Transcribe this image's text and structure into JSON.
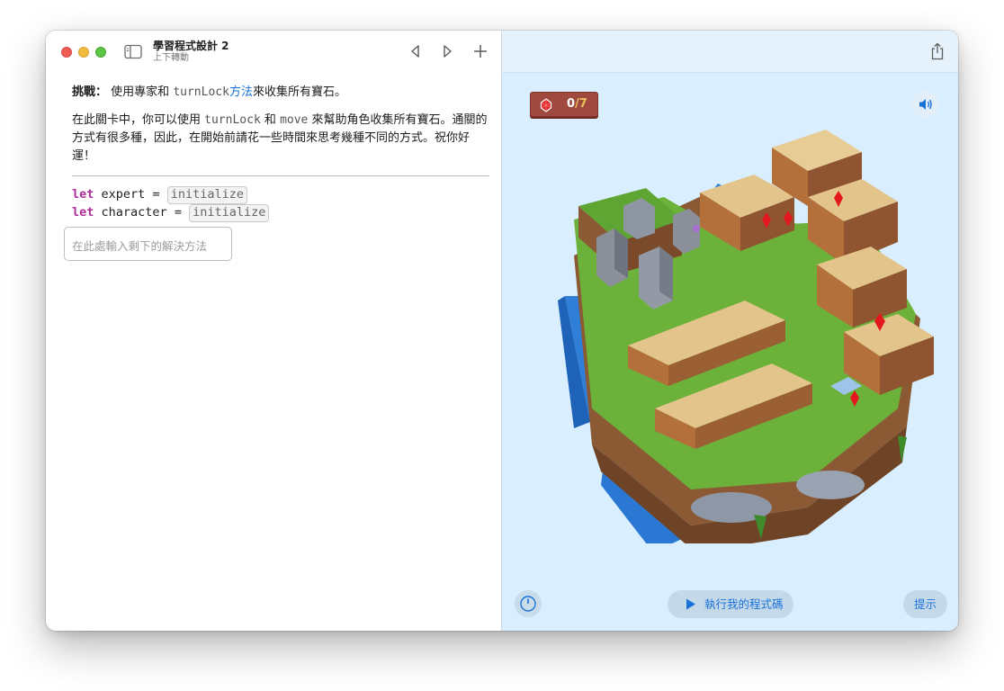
{
  "window": {
    "title": "學習程式設計 2",
    "subtitle": "上下轉動"
  },
  "toolbar": {
    "icons": [
      "sidebar-toggle-icon",
      "chevron-left-icon",
      "chevron-right-icon",
      "plus-icon",
      "share-icon"
    ]
  },
  "instructions": {
    "challenge_label": "挑戰：",
    "challenge_text_1": "使用專家和",
    "challenge_code": "turnLock",
    "challenge_link": "方法",
    "challenge_text_2": "來收集所有寶石。",
    "desc_1": "在此關卡中，你可以使用",
    "desc_code_1": "turnLock",
    "desc_2": "和",
    "desc_code_2": "move",
    "desc_3": "來幫助角色收集所有寶石。通關的方式有很多種，因此，在開始前請花一些時間來思考幾種不同的方式。祝你好運！"
  },
  "code": {
    "line1": {
      "keyword": "let",
      "name": "expert",
      "op": "=",
      "placeholder": "initialize"
    },
    "line2": {
      "keyword": "let",
      "name": "character",
      "op": "=",
      "placeholder": "initialize"
    },
    "input_placeholder": "在此處輸入剩下的解決方法"
  },
  "live_view": {
    "gems_collected": "0",
    "gems_separator": "/",
    "gems_total": "7",
    "run_label": "執行我的程式碼",
    "hint_label": "提示"
  },
  "colors": {
    "keyword": "#ad2e9b",
    "link": "#1a72d8",
    "live_view_bg": "#d9efff",
    "gem_counter_bg": "#a04a3f"
  }
}
